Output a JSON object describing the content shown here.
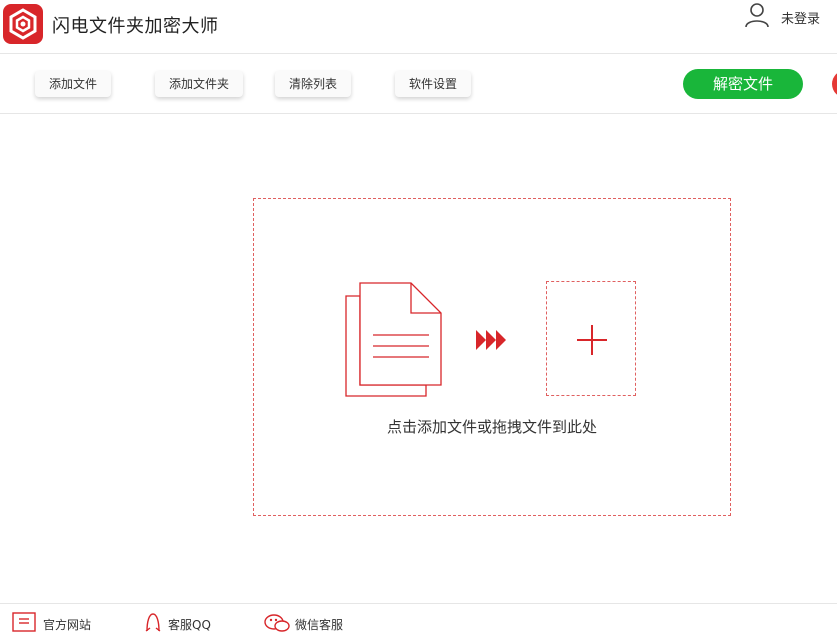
{
  "app": {
    "title": "闪电文件夹加密大师",
    "accent_color": "#d8262a"
  },
  "user": {
    "status": "未登录",
    "icon": "user-icon"
  },
  "toolbar": {
    "add_file": "添加文件",
    "add_folder": "添加文件夹",
    "clear_list": "清除列表",
    "settings": "软件设置",
    "decrypt": "解密文件",
    "decrypt_color": "#19b63a"
  },
  "dropzone": {
    "hint": "点击添加文件或拖拽文件到此处",
    "icons": [
      "document-icon",
      "arrows-icon",
      "plus-icon"
    ],
    "border_color": "#e06060"
  },
  "footer": {
    "website": "官方网站",
    "qq": "客服QQ",
    "wechat": "微信客服"
  }
}
